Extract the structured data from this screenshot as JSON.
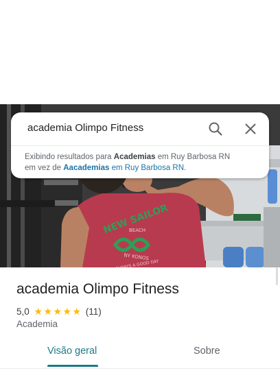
{
  "search": {
    "query": "academia Olimpo Fitness",
    "notice_prefix": "Exibindo resultados para ",
    "notice_term": "Academias",
    "notice_location1": " em Ruy Barbosa RN",
    "notice_mid": "em vez de ",
    "notice_original": "Aacademias",
    "notice_location2": " em Ruy Barbosa RN",
    "notice_end": "."
  },
  "icons": {
    "search": "search-icon",
    "close": "close-icon",
    "star": "star-icon"
  },
  "photo": {
    "shirt_text_top": "NEW SAILOR",
    "shirt_text_beach": "BEACH",
    "shirt_text_bottom": "NY KONOS",
    "shirt_text_always": "ALWAYS A GOOD DAY"
  },
  "place": {
    "name": "academia Olimpo Fitness",
    "rating": "5,0",
    "stars": 5,
    "review_count": "(11)",
    "category": "Academia"
  },
  "tabs": [
    {
      "label": "Visão geral",
      "active": true
    },
    {
      "label": "Sobre",
      "active": false
    }
  ],
  "colors": {
    "accent": "#1a7a86",
    "link": "#1a73a8",
    "star": "#fbbc04",
    "shirt": "#b83a4e",
    "shirt_print": "#2e9e58"
  }
}
